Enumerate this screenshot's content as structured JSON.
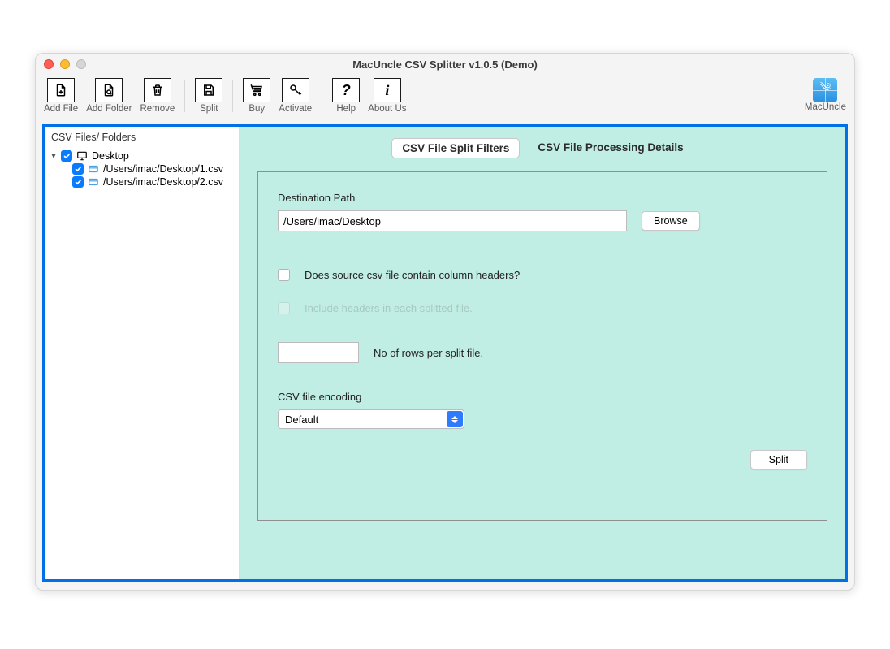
{
  "window": {
    "title": "MacUncle CSV Splitter v1.0.5 (Demo)"
  },
  "toolbar": {
    "add_file": "Add File",
    "add_folder": "Add Folder",
    "remove": "Remove",
    "split": "Split",
    "buy": "Buy",
    "activate": "Activate",
    "help": "Help",
    "about": "About Us",
    "brand": "MacUncle"
  },
  "sidebar": {
    "heading": "CSV Files/ Folders",
    "root": "Desktop",
    "files": [
      "/Users/imac/Desktop/1.csv",
      "/Users/imac/Desktop/2.csv"
    ]
  },
  "tabs": {
    "filters": "CSV File Split Filters",
    "processing": "CSV File Processing Details"
  },
  "form": {
    "dest_label": "Destination Path",
    "dest_value": "/Users/imac/Desktop",
    "browse": "Browse",
    "has_headers": "Does source csv file contain column headers?",
    "include_headers": "Include headers in each splitted file.",
    "rows_label": "No of rows per split file.",
    "rows_value": "",
    "encoding_label": "CSV file encoding",
    "encoding_value": "Default",
    "split_btn": "Split"
  }
}
